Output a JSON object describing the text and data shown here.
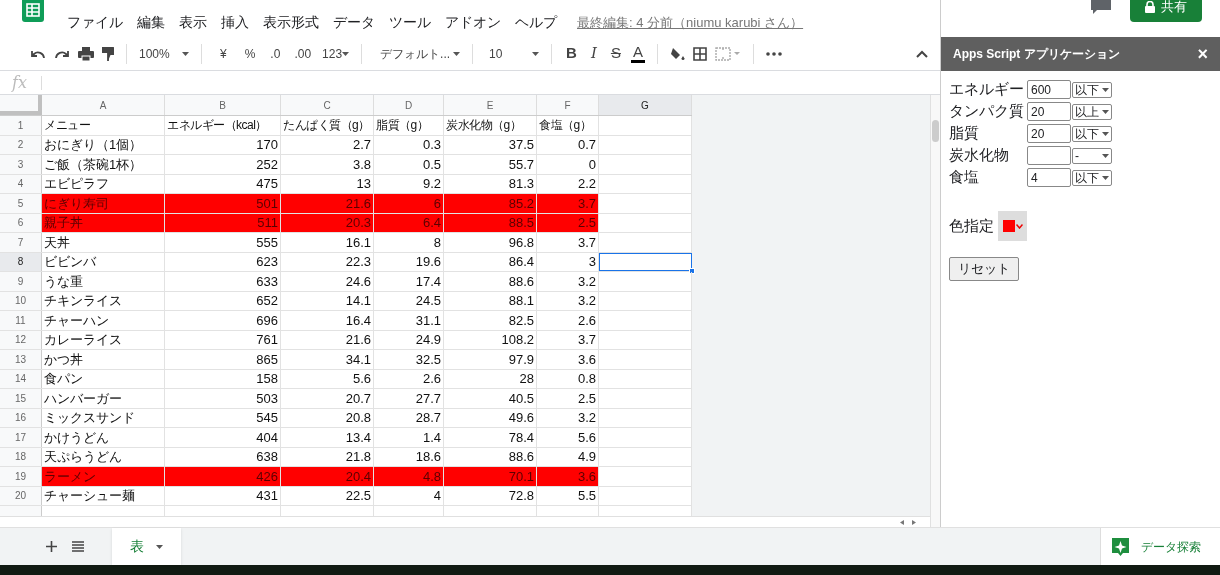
{
  "menu_bar": {
    "items": [
      "ファイル",
      "編集",
      "表示",
      "挿入",
      "表示形式",
      "データ",
      "ツール",
      "アドオン",
      "ヘルプ"
    ],
    "last_edit": "最終編集: 4 分前（niumu karubi さん）"
  },
  "share_button": "共有",
  "toolbar": {
    "zoom": "100%",
    "currency": "¥",
    "percent": "%",
    "decimal_decrease": ".0",
    "decimal_increase": ".00",
    "number_format": "123",
    "font": "デフォルト...",
    "font_size": "10",
    "format_buttons": [
      {
        "kind": "bold",
        "label": "B"
      },
      {
        "kind": "italic",
        "label": "I"
      },
      {
        "kind": "strikethrough",
        "label": "S"
      },
      {
        "kind": "text_color",
        "label": "A"
      }
    ]
  },
  "formula_bar": {
    "label": "fx"
  },
  "sheet": {
    "columns": [
      {
        "label": "A",
        "selected": false
      },
      {
        "label": "B",
        "selected": false
      },
      {
        "label": "C",
        "selected": false
      },
      {
        "label": "D",
        "selected": false
      },
      {
        "label": "E",
        "selected": false
      },
      {
        "label": "F",
        "selected": false
      },
      {
        "label": "G",
        "selected": true
      }
    ],
    "rows": [
      {
        "number": "1",
        "cells": [
          "メニュー",
          "エネルギー（kcal）",
          "たんぱく質（g）",
          "脂質（g）",
          "炭水化物（g）",
          "食塩（g）"
        ],
        "highlighted": false,
        "selected": false
      },
      {
        "number": "2",
        "cells": [
          "おにぎり（1個）",
          "170",
          "2.7",
          "0.3",
          "37.5",
          "0.7"
        ],
        "highlighted": false,
        "selected": false
      },
      {
        "number": "3",
        "cells": [
          "ご飯（茶碗1杯）",
          "252",
          "3.8",
          "0.5",
          "55.7",
          "0"
        ],
        "highlighted": false,
        "selected": false
      },
      {
        "number": "4",
        "cells": [
          "エビピラフ",
          "475",
          "13",
          "9.2",
          "81.3",
          "2.2"
        ],
        "highlighted": false,
        "selected": false
      },
      {
        "number": "5",
        "cells": [
          "にぎり寿司",
          "501",
          "21.6",
          "6",
          "85.2",
          "3.7"
        ],
        "highlighted": true,
        "selected": false
      },
      {
        "number": "6",
        "cells": [
          "親子丼",
          "511",
          "20.3",
          "6.4",
          "88.5",
          "2.5"
        ],
        "highlighted": true,
        "selected": false
      },
      {
        "number": "7",
        "cells": [
          "天丼",
          "555",
          "16.1",
          "8",
          "96.8",
          "3.7"
        ],
        "highlighted": false,
        "selected": false
      },
      {
        "number": "8",
        "cells": [
          "ビビンバ",
          "623",
          "22.3",
          "19.6",
          "86.4",
          "3"
        ],
        "highlighted": false,
        "selected": true
      },
      {
        "number": "9",
        "cells": [
          "うな重",
          "633",
          "24.6",
          "17.4",
          "88.6",
          "3.2"
        ],
        "highlighted": false,
        "selected": false
      },
      {
        "number": "10",
        "cells": [
          "チキンライス",
          "652",
          "14.1",
          "24.5",
          "88.1",
          "3.2"
        ],
        "highlighted": false,
        "selected": false
      },
      {
        "number": "11",
        "cells": [
          "チャーハン",
          "696",
          "16.4",
          "31.1",
          "82.5",
          "2.6"
        ],
        "highlighted": false,
        "selected": false
      },
      {
        "number": "12",
        "cells": [
          "カレーライス",
          "761",
          "21.6",
          "24.9",
          "108.2",
          "3.7"
        ],
        "highlighted": false,
        "selected": false
      },
      {
        "number": "13",
        "cells": [
          "かつ丼",
          "865",
          "34.1",
          "32.5",
          "97.9",
          "3.6"
        ],
        "highlighted": false,
        "selected": false
      },
      {
        "number": "14",
        "cells": [
          "食パン",
          "158",
          "5.6",
          "2.6",
          "28",
          "0.8"
        ],
        "highlighted": false,
        "selected": false
      },
      {
        "number": "15",
        "cells": [
          "ハンバーガー",
          "503",
          "20.7",
          "27.7",
          "40.5",
          "2.5"
        ],
        "highlighted": false,
        "selected": false
      },
      {
        "number": "16",
        "cells": [
          "ミックスサンド",
          "545",
          "20.8",
          "28.7",
          "49.6",
          "3.2"
        ],
        "highlighted": false,
        "selected": false
      },
      {
        "number": "17",
        "cells": [
          "かけうどん",
          "404",
          "13.4",
          "1.4",
          "78.4",
          "5.6"
        ],
        "highlighted": false,
        "selected": false
      },
      {
        "number": "18",
        "cells": [
          "天ぷらうどん",
          "638",
          "21.8",
          "18.6",
          "88.6",
          "4.9"
        ],
        "highlighted": false,
        "selected": false
      },
      {
        "number": "19",
        "cells": [
          "ラーメン",
          "426",
          "20.4",
          "4.8",
          "70.1",
          "3.6"
        ],
        "highlighted": true,
        "selected": false
      },
      {
        "number": "20",
        "cells": [
          "チャーシュー麺",
          "431",
          "22.5",
          "4",
          "72.8",
          "5.5"
        ],
        "highlighted": false,
        "selected": false
      }
    ]
  },
  "sheet_tabs": [
    {
      "label": "表",
      "selected": true
    }
  ],
  "explore_button": "データ探索",
  "sidebar": {
    "title": "Apps Script アプリケーション",
    "close": "×",
    "filters": [
      {
        "label": "エネルギー",
        "value": "600",
        "operator": "以下"
      },
      {
        "label": "タンパク質",
        "value": "20",
        "operator": "以上"
      },
      {
        "label": "脂質",
        "value": "20",
        "operator": "以下"
      },
      {
        "label": "炭水化物",
        "operator": "-"
      },
      {
        "label": "食塩",
        "value": "4",
        "operator": "以下"
      }
    ],
    "color_label": "色指定",
    "color": "#ff0000",
    "reset_button": "リセット"
  }
}
